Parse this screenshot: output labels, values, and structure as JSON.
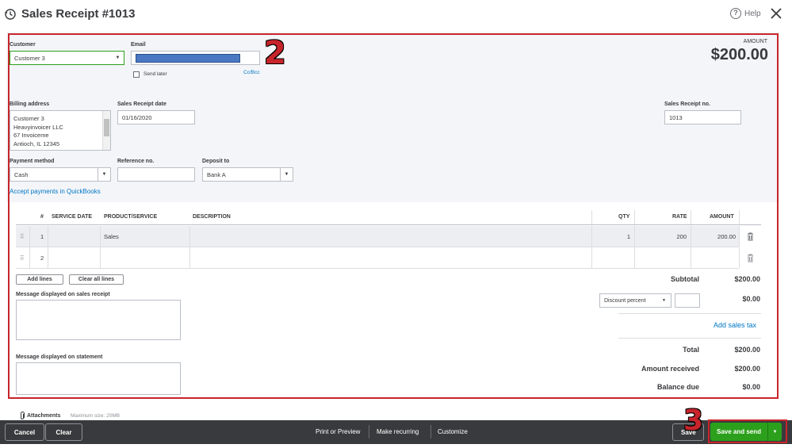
{
  "header": {
    "title": "Sales Receipt #1013",
    "help_label": "Help"
  },
  "customer": {
    "label": "Customer",
    "value": "Customer 3"
  },
  "email": {
    "label": "Email",
    "send_later_label": "Send later",
    "cc_bcc_label": "Cc/Bcc",
    "redaction_color": "#4a78c2"
  },
  "amount": {
    "label": "AMOUNT",
    "value": "$200.00"
  },
  "billing_address": {
    "label": "Billing address",
    "lines": [
      "Customer 3",
      "Heavyinvoicer LLC",
      "67 Invoiceme",
      "Antioch, IL  12345"
    ]
  },
  "receipt_date": {
    "label": "Sales Receipt date",
    "value": "01/16/2020"
  },
  "receipt_no": {
    "label": "Sales Receipt no.",
    "value": "1013"
  },
  "payment_method": {
    "label": "Payment method",
    "value": "Cash"
  },
  "reference_no": {
    "label": "Reference no.",
    "value": ""
  },
  "deposit_to": {
    "label": "Deposit to",
    "value": "Bank A"
  },
  "accept_payments_link": "Accept payments in QuickBooks",
  "table": {
    "columns": [
      "#",
      "SERVICE DATE",
      "PRODUCT/SERVICE",
      "DESCRIPTION",
      "QTY",
      "RATE",
      "AMOUNT"
    ],
    "rows": [
      {
        "num": "1",
        "service_date": "",
        "product": "Sales",
        "description": "",
        "qty": "1",
        "rate": "200",
        "amount": "200.00"
      },
      {
        "num": "2",
        "service_date": "",
        "product": "",
        "description": "",
        "qty": "",
        "rate": "",
        "amount": ""
      }
    ]
  },
  "buttons": {
    "add_lines": "Add lines",
    "clear_all_lines": "Clear all lines"
  },
  "messages": {
    "receipt_label": "Message displayed on sales receipt",
    "statement_label": "Message displayed on statement"
  },
  "totals": {
    "subtotal_label": "Subtotal",
    "subtotal_value": "$200.00",
    "discount_select": "Discount percent",
    "discount_value": "$0.00",
    "add_sales_tax": "Add sales tax",
    "total_label": "Total",
    "total_value": "$200.00",
    "amount_received_label": "Amount received",
    "amount_received_value": "$200.00",
    "balance_due_label": "Balance due",
    "balance_due_value": "$0.00"
  },
  "attachments": {
    "label": "Attachments",
    "max_size": "Maximum size: 20MB"
  },
  "footer": {
    "cancel": "Cancel",
    "clear": "Clear",
    "print_preview": "Print or Preview",
    "make_recurring": "Make recurring",
    "customize": "Customize",
    "save_partial": "Save",
    "save_and_send": "Save and send"
  },
  "annotations": {
    "step2": "2",
    "step3": "3"
  }
}
